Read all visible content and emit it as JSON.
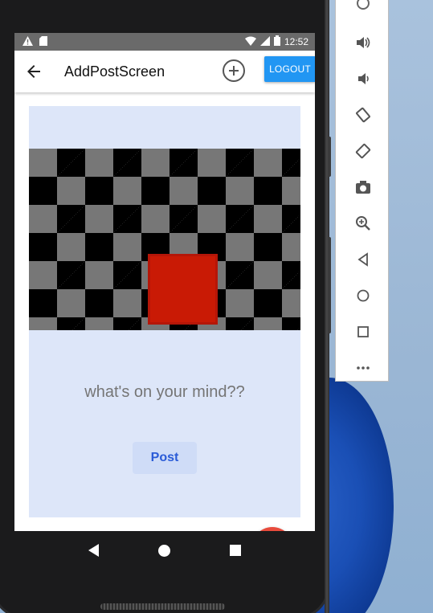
{
  "status_bar": {
    "time": "12:52",
    "left_icons": [
      "warning-icon",
      "sim-card-icon"
    ],
    "right_icons": [
      "wifi-icon",
      "signal-icon",
      "battery-icon"
    ]
  },
  "app_bar": {
    "title": "AddPostScreen",
    "back_icon": "arrow-back-icon",
    "add_icon": "add-circle-icon",
    "logout_label": "LOGOUT",
    "logout_color": "#2196f3"
  },
  "post_card": {
    "background": "#dde6f9",
    "image_description_icon": "checkerboard-image-placeholder",
    "input_placeholder": "what's on your mind??",
    "post_label": "Post"
  },
  "fab": {
    "label": "+",
    "color": "#e84b3c"
  },
  "nav_bar": {
    "icons": [
      "nav-back-icon",
      "nav-home-icon",
      "nav-recents-icon"
    ]
  },
  "emulator_toolbar": {
    "tools": [
      "power-icon",
      "volume-up-icon",
      "volume-down-icon",
      "rotate-left-icon",
      "rotate-right-icon",
      "camera-icon",
      "zoom-icon",
      "back-triangle-icon",
      "home-circle-icon",
      "overview-square-icon",
      "more-icon"
    ]
  }
}
